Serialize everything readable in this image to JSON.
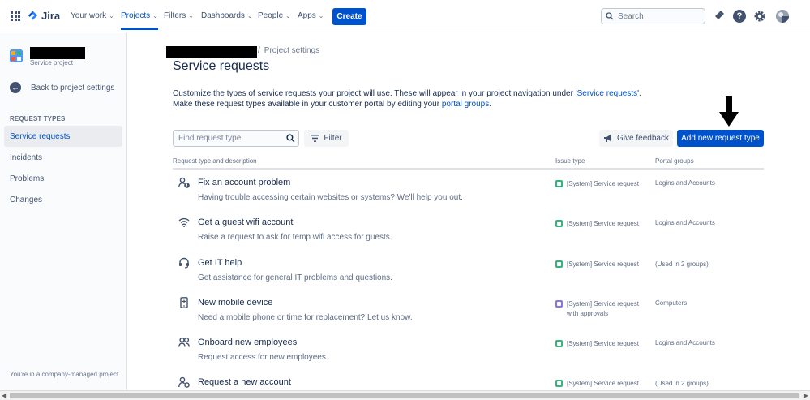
{
  "topnav": {
    "logo_text": "Jira",
    "items": [
      {
        "label": "Your work"
      },
      {
        "label": "Projects"
      },
      {
        "label": "Filters"
      },
      {
        "label": "Dashboards"
      },
      {
        "label": "People"
      },
      {
        "label": "Apps"
      }
    ],
    "create_label": "Create",
    "search_placeholder": "Search",
    "active_item": "Projects",
    "accent_color": "#0052cc"
  },
  "sidebar": {
    "project_type": "Service project",
    "back_label": "Back to project settings",
    "section_heading": "REQUEST TYPES",
    "items": [
      {
        "label": "Service requests",
        "selected": true
      },
      {
        "label": "Incidents"
      },
      {
        "label": "Problems"
      },
      {
        "label": "Changes"
      }
    ],
    "footer": "You're in a company-managed project"
  },
  "breadcrumb": {
    "separator": "/",
    "current": "Project settings"
  },
  "main": {
    "title": "Service requests",
    "desc_line1_pre": "Customize the types of service requests your project will use. These will appear in your project navigation under '",
    "desc_line1_link": "Service requests",
    "desc_line1_post": "'.",
    "desc_line2_pre": "Make these request types available in your customer portal by editing your ",
    "desc_line2_link": "portal groups",
    "desc_line2_post": ".",
    "find_placeholder": "Find request type",
    "filter_label": "Filter",
    "feedback_label": "Give feedback",
    "add_label": "Add new request type"
  },
  "table": {
    "headers": {
      "type": "Request type and description",
      "issue": "Issue type",
      "portal": "Portal groups"
    },
    "rows": [
      {
        "icon": "user-alert-icon",
        "title": "Fix an account problem",
        "desc": "Having trouble accessing certain websites or systems? We'll help you out.",
        "issue_l1": "[System] Service request",
        "issue_l2": "",
        "issue_color": "#36b37e",
        "portal": "Logins and Accounts"
      },
      {
        "icon": "wifi-icon",
        "title": "Get a guest wifi account",
        "desc": "Raise a request to ask for temp wifi access for guests.",
        "issue_l1": "[System] Service request",
        "issue_l2": "",
        "issue_color": "#36b37e",
        "portal": "Logins and Accounts"
      },
      {
        "icon": "headset-icon",
        "title": "Get IT help",
        "desc": "Get assistance for general IT problems and questions.",
        "issue_l1": "[System] Service request",
        "issue_l2": "",
        "issue_color": "#36b37e",
        "portal": "(Used in 2 groups)"
      },
      {
        "icon": "mobile-device-icon",
        "title": "New mobile device",
        "desc": "Need a mobile phone or time for replacement? Let us know.",
        "issue_l1": "[System] Service request",
        "issue_l2": "with approvals",
        "issue_color": "#8777d9",
        "portal": "Computers"
      },
      {
        "icon": "people-icon",
        "title": "Onboard new employees",
        "desc": "Request access for new employees.",
        "issue_l1": "[System] Service request",
        "issue_l2": "",
        "issue_color": "#36b37e",
        "portal": "Logins and Accounts"
      },
      {
        "icon": "user-add-icon",
        "title": "Request a new account",
        "desc": "",
        "issue_l1": "[System] Service request",
        "issue_l2": "",
        "issue_color": "#36b37e",
        "portal": "(Used in 2 groups)"
      }
    ]
  }
}
